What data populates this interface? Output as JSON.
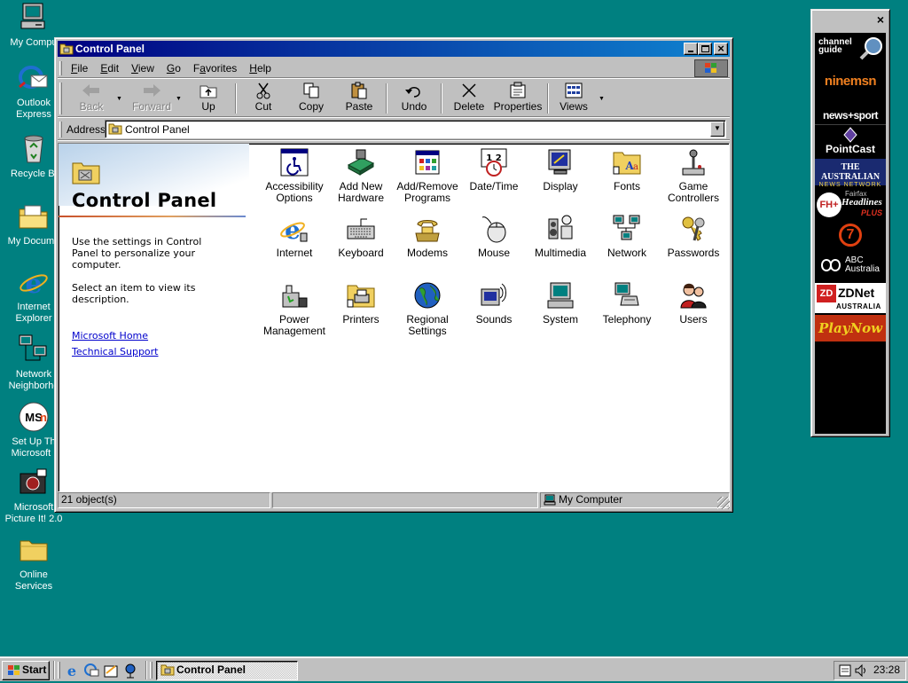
{
  "desktop": {
    "icons": [
      {
        "label": "My Compu",
        "icon": "my-computer-icon"
      },
      {
        "label": "Outlook Express",
        "icon": "outlook-express-icon"
      },
      {
        "label": "Recycle Bi",
        "icon": "recycle-bin-icon"
      },
      {
        "label": "My Docume",
        "icon": "my-documents-icon"
      },
      {
        "label": "Internet Explorer",
        "icon": "internet-explorer-icon"
      },
      {
        "label": "Network Neighborho",
        "icon": "network-neighborhood-icon"
      },
      {
        "label": "Set Up Th Microsoft .",
        "icon": "msn-setup-icon"
      },
      {
        "label": "Microsoft Picture It! 2.0",
        "icon": "picture-it-icon"
      },
      {
        "label": "Online Services",
        "icon": "online-services-folder-icon"
      }
    ],
    "background_color": "#008080"
  },
  "window": {
    "title": "Control Panel",
    "controls": {
      "minimize": "_",
      "maximize": "□",
      "close": "×"
    },
    "menu": [
      "File",
      "Edit",
      "View",
      "Go",
      "Favorites",
      "Help"
    ],
    "menu_access_keys": [
      "F",
      "E",
      "V",
      "G",
      "a",
      "H"
    ],
    "toolbar": {
      "back": "Back",
      "forward": "Forward",
      "up": "Up",
      "cut": "Cut",
      "copy": "Copy",
      "paste": "Paste",
      "undo": "Undo",
      "delete": "Delete",
      "properties": "Properties",
      "views": "Views"
    },
    "address": {
      "label": "Address",
      "value": "Control Panel"
    },
    "left_pane": {
      "title": "Control Panel",
      "description": "Use the settings in Control Panel to personalize your computer.",
      "hint": "Select an item to view its description.",
      "links": [
        "Microsoft Home",
        "Technical Support"
      ]
    },
    "items": [
      {
        "label": "Accessibility Options",
        "icon": "accessibility-icon"
      },
      {
        "label": "Add New Hardware",
        "icon": "add-hardware-icon"
      },
      {
        "label": "Add/Remove Programs",
        "icon": "add-remove-programs-icon"
      },
      {
        "label": "Date/Time",
        "icon": "date-time-icon"
      },
      {
        "label": "Display",
        "icon": "display-icon"
      },
      {
        "label": "Fonts",
        "icon": "fonts-icon"
      },
      {
        "label": "Game Controllers",
        "icon": "game-controllers-icon"
      },
      {
        "label": "Internet",
        "icon": "internet-icon"
      },
      {
        "label": "Keyboard",
        "icon": "keyboard-icon"
      },
      {
        "label": "Modems",
        "icon": "modems-icon"
      },
      {
        "label": "Mouse",
        "icon": "mouse-icon"
      },
      {
        "label": "Multimedia",
        "icon": "multimedia-icon"
      },
      {
        "label": "Network",
        "icon": "network-icon"
      },
      {
        "label": "Passwords",
        "icon": "passwords-icon"
      },
      {
        "label": "Power Management",
        "icon": "power-management-icon"
      },
      {
        "label": "Printers",
        "icon": "printers-icon"
      },
      {
        "label": "Regional Settings",
        "icon": "regional-settings-icon"
      },
      {
        "label": "Sounds",
        "icon": "sounds-icon"
      },
      {
        "label": "System",
        "icon": "system-icon"
      },
      {
        "label": "Telephony",
        "icon": "telephony-icon"
      },
      {
        "label": "Users",
        "icon": "users-icon"
      }
    ],
    "status": {
      "count": "21 object(s)",
      "zone": "My Computer"
    }
  },
  "channel_bar": {
    "close": "×",
    "channels": [
      {
        "label": "channel guide",
        "icon": "channel-guide-icon"
      },
      {
        "label": "ninemsn",
        "icon": "ninemsn-icon"
      },
      {
        "label": "news+sport",
        "icon": "news-sport-icon"
      },
      {
        "label": "PointCast",
        "icon": "pointcast-icon"
      },
      {
        "label": "THE AUSTRALIAN",
        "sub": "NEWS NETWORK",
        "icon": "australian-news-icon"
      },
      {
        "label": "Headlines",
        "pre": "Fairfax",
        "sub": "PLUS",
        "badge": "FH+",
        "icon": "fairfax-headlines-icon"
      },
      {
        "label": "7",
        "icon": "channel-seven-icon"
      },
      {
        "label": "ABC Australia",
        "icon": "abc-australia-icon"
      },
      {
        "label": "ZDNet",
        "sub": "AUSTRALIA",
        "icon": "zdnet-icon"
      },
      {
        "label": "PlayNow",
        "icon": "playnow-icon"
      }
    ]
  },
  "taskbar": {
    "start": "Start",
    "task": "Control Panel",
    "clock": "23:28",
    "quick_launch": [
      "internet-explorer-icon",
      "outlook-express-icon",
      "show-desktop-icon",
      "channels-icon"
    ]
  }
}
